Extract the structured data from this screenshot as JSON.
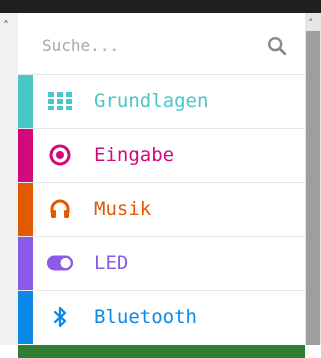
{
  "search": {
    "placeholder": "Suche..."
  },
  "categories": [
    {
      "label": "Grundlagen",
      "color": "#4ac6c6",
      "icon": "grid-icon"
    },
    {
      "label": "Eingabe",
      "color": "#d10a7c",
      "icon": "target-icon"
    },
    {
      "label": "Musik",
      "color": "#e25a00",
      "icon": "headphones-icon"
    },
    {
      "label": "LED",
      "color": "#8a5be6",
      "icon": "toggle-icon"
    },
    {
      "label": "Bluetooth",
      "color": "#0a8ae6",
      "icon": "bluetooth-icon"
    }
  ]
}
